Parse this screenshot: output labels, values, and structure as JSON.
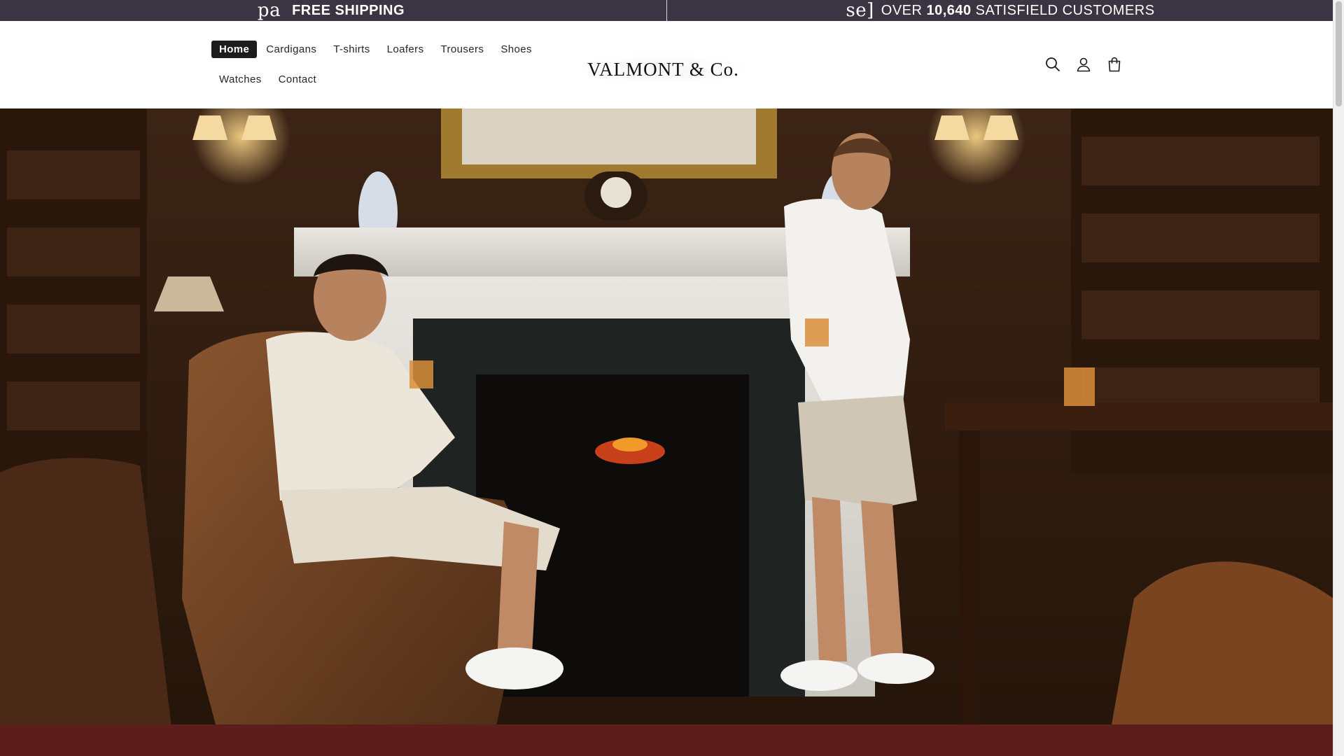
{
  "announcement": {
    "left": {
      "glyph": "pa",
      "bold": "FREE SHIPPING"
    },
    "right": {
      "glyph": "se]",
      "prefix": "OVER",
      "count": "10,640",
      "suffix": "SATISFIELD CUSTOMERS"
    }
  },
  "nav": {
    "items": [
      {
        "label": "Home",
        "active": true
      },
      {
        "label": "Cardigans"
      },
      {
        "label": "T-shirts"
      },
      {
        "label": "Loafers"
      },
      {
        "label": "Trousers"
      },
      {
        "label": "Shoes"
      },
      {
        "label": "Watches"
      },
      {
        "label": "Contact"
      }
    ]
  },
  "brand": {
    "logo_text": "VALMONT & Co."
  },
  "header_icons": [
    "search-icon",
    "account-icon",
    "cart-icon"
  ],
  "hero": {
    "image": "hero-library-fireplace-two-men"
  },
  "colors": {
    "announcement_bg": "#3b3442",
    "active_nav_bg": "#1c1c1c",
    "header_bg": "#ffffff"
  }
}
